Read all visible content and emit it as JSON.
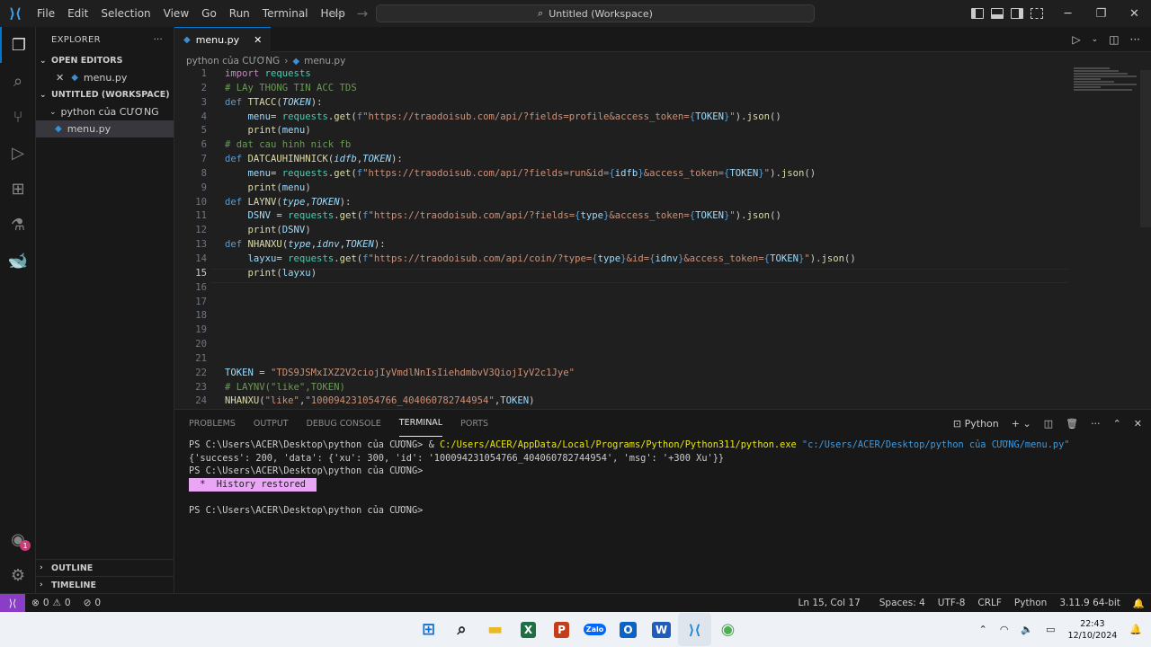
{
  "titlebar": {
    "menus": [
      "File",
      "Edit",
      "Selection",
      "View",
      "Go",
      "Run",
      "Terminal",
      "Help"
    ],
    "search": "Untitled (Workspace)"
  },
  "sidebar": {
    "title": "EXPLORER",
    "open_editors": "OPEN EDITORS",
    "open_file": "menu.py",
    "workspace": "UNTITLED (WORKSPACE)",
    "folder": "python của CƯƠNG",
    "file": "menu.py",
    "outline": "OUTLINE",
    "timeline": "TIMELINE"
  },
  "editor": {
    "tab": "menu.py",
    "breadcrumb_folder": "python của CƯƠNG",
    "breadcrumb_file": "menu.py",
    "lines": [
      "import requests",
      "# LAy THONG TIN ACC TDS",
      "def TTACC(TOKEN):",
      "    menu= requests.get(f\"https://traodoisub.com/api/?fields=profile&access_token={TOKEN}\").json()",
      "    print(menu)",
      "# dat cau hinh nick fb",
      "def DATCAUHINHNICK(idfb,TOKEN):",
      "    menu= requests.get(f\"https://traodoisub.com/api/?fields=run&id={idfb}&access_token={TOKEN}\").json()",
      "    print(menu)",
      "def LAYNV(type,TOKEN):",
      "    DSNV = requests.get(f\"https://traodoisub.com/api/?fields={type}&access_token={TOKEN}\").json()",
      "    print(DSNV)",
      "def NHANXU(type,idnv,TOKEN):",
      "    layxu= requests.get(f\"https://traodoisub.com/api/coin/?type={type}&id={idnv}&access_token={TOKEN}\").json()",
      "    print(layxu)",
      "",
      "",
      "",
      "",
      "",
      "",
      "TOKEN = \"TDS9JSMxIXZ2V2ciojIyVmdlNnIsIiehdmbvV3QiojIyV2c1Jye\"",
      "# LAYNV(\"like\",TOKEN)",
      "NHANXU(\"like\",\"100094231054766_404060782744954\",TOKEN)"
    ]
  },
  "panel": {
    "tabs": [
      "PROBLEMS",
      "OUTPUT",
      "DEBUG CONSOLE",
      "TERMINAL",
      "PORTS"
    ],
    "active_tab": "TERMINAL",
    "shell": "Python",
    "terminal": {
      "line1_prompt": "PS C:\\Users\\ACER\\Desktop\\python của CƯƠNG> & ",
      "line1_cmd": "C:/Users/ACER/AppData/Local/Programs/Python/Python311/python.exe",
      "line1_arg": " \"c:/Users/ACER/Desktop/python của CƯƠNG/menu.py\"",
      "line2": "{'success': 200, 'data': {'xu': 300, 'id': '100094231054766_404060782744954', 'msg': '+300 Xu'}}",
      "line3": "PS C:\\Users\\ACER\\Desktop\\python của CƯƠNG>",
      "history": " *  History restored ",
      "line5": "PS C:\\Users\\ACER\\Desktop\\python của CƯƠNG>"
    }
  },
  "statusbar": {
    "errors": "0",
    "warnings": "0",
    "ports": "0",
    "position": "Ln 15, Col 17",
    "spaces": "Spaces: 4",
    "encoding": "UTF-8",
    "eol": "CRLF",
    "language": "Python",
    "interpreter": "3.11.9 64-bit"
  },
  "taskbar": {
    "time": "22:43",
    "date": "12/10/2024"
  },
  "colors": {
    "accent": "#0078d4",
    "keyword": "#c586c0",
    "string": "#ce9178",
    "function": "#dcdcaa"
  }
}
